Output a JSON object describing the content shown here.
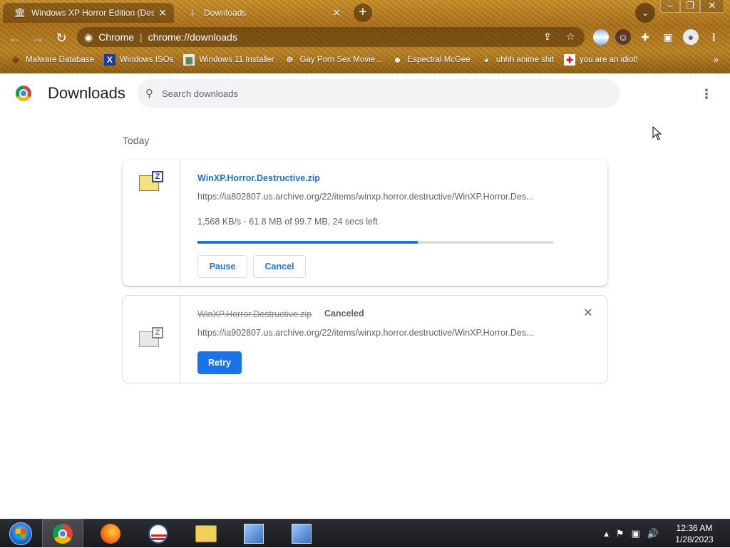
{
  "browser": {
    "tabs": [
      {
        "title": "Windows XP Horror Edition (Dest",
        "close": "✕"
      },
      {
        "title": "Downloads",
        "close": "✕"
      }
    ],
    "new_tab": "+",
    "window_controls": {
      "minimize": "–",
      "restore": "❐",
      "close": "✕"
    },
    "address": {
      "scheme_label": "Chrome",
      "separator": "|",
      "url": "chrome://downloads"
    },
    "bookmarks": [
      {
        "label": "Malware Database",
        "icon": "bug-icon"
      },
      {
        "label": "Windows ISOs",
        "icon": "x-icon"
      },
      {
        "label": "Windows 11 Installer",
        "icon": "image-icon"
      },
      {
        "label": "Gay Porn Sex Movie...",
        "icon": "bookmark-favicon"
      },
      {
        "label": "Espectral McGee",
        "icon": "face-icon"
      },
      {
        "label": "uhhh anime shit",
        "icon": "anime-icon"
      },
      {
        "label": "you are an idiot!",
        "icon": "flag-icon"
      }
    ],
    "bookmarks_more": "»"
  },
  "page": {
    "title": "Downloads",
    "search_placeholder": "Search downloads",
    "section": "Today",
    "downloads": [
      {
        "filename": "WinXP.Horror.Destructive.zip",
        "url": "https://ia802807.us.archive.org/22/items/winxp.horror.destructive/WinXP.Horror.Des...",
        "progress_text": "1,568 KB/s - 61.8 MB of 99.7 MB, 24 secs left",
        "progress_fraction": 0.62,
        "buttons": {
          "pause": "Pause",
          "cancel": "Cancel"
        }
      },
      {
        "filename": "WinXP.Horror.Destructive.zip",
        "status": "Canceled",
        "url": "https://ia902807.us.archive.org/22/items/winxp.horror.destructive/WinXP.Horror.Des...",
        "buttons": {
          "retry": "Retry"
        }
      }
    ]
  },
  "taskbar": {
    "time": "12:36 AM",
    "date": "1/28/2023"
  },
  "colors": {
    "accent": "#1a73e8",
    "text_secondary": "#5f6368"
  }
}
